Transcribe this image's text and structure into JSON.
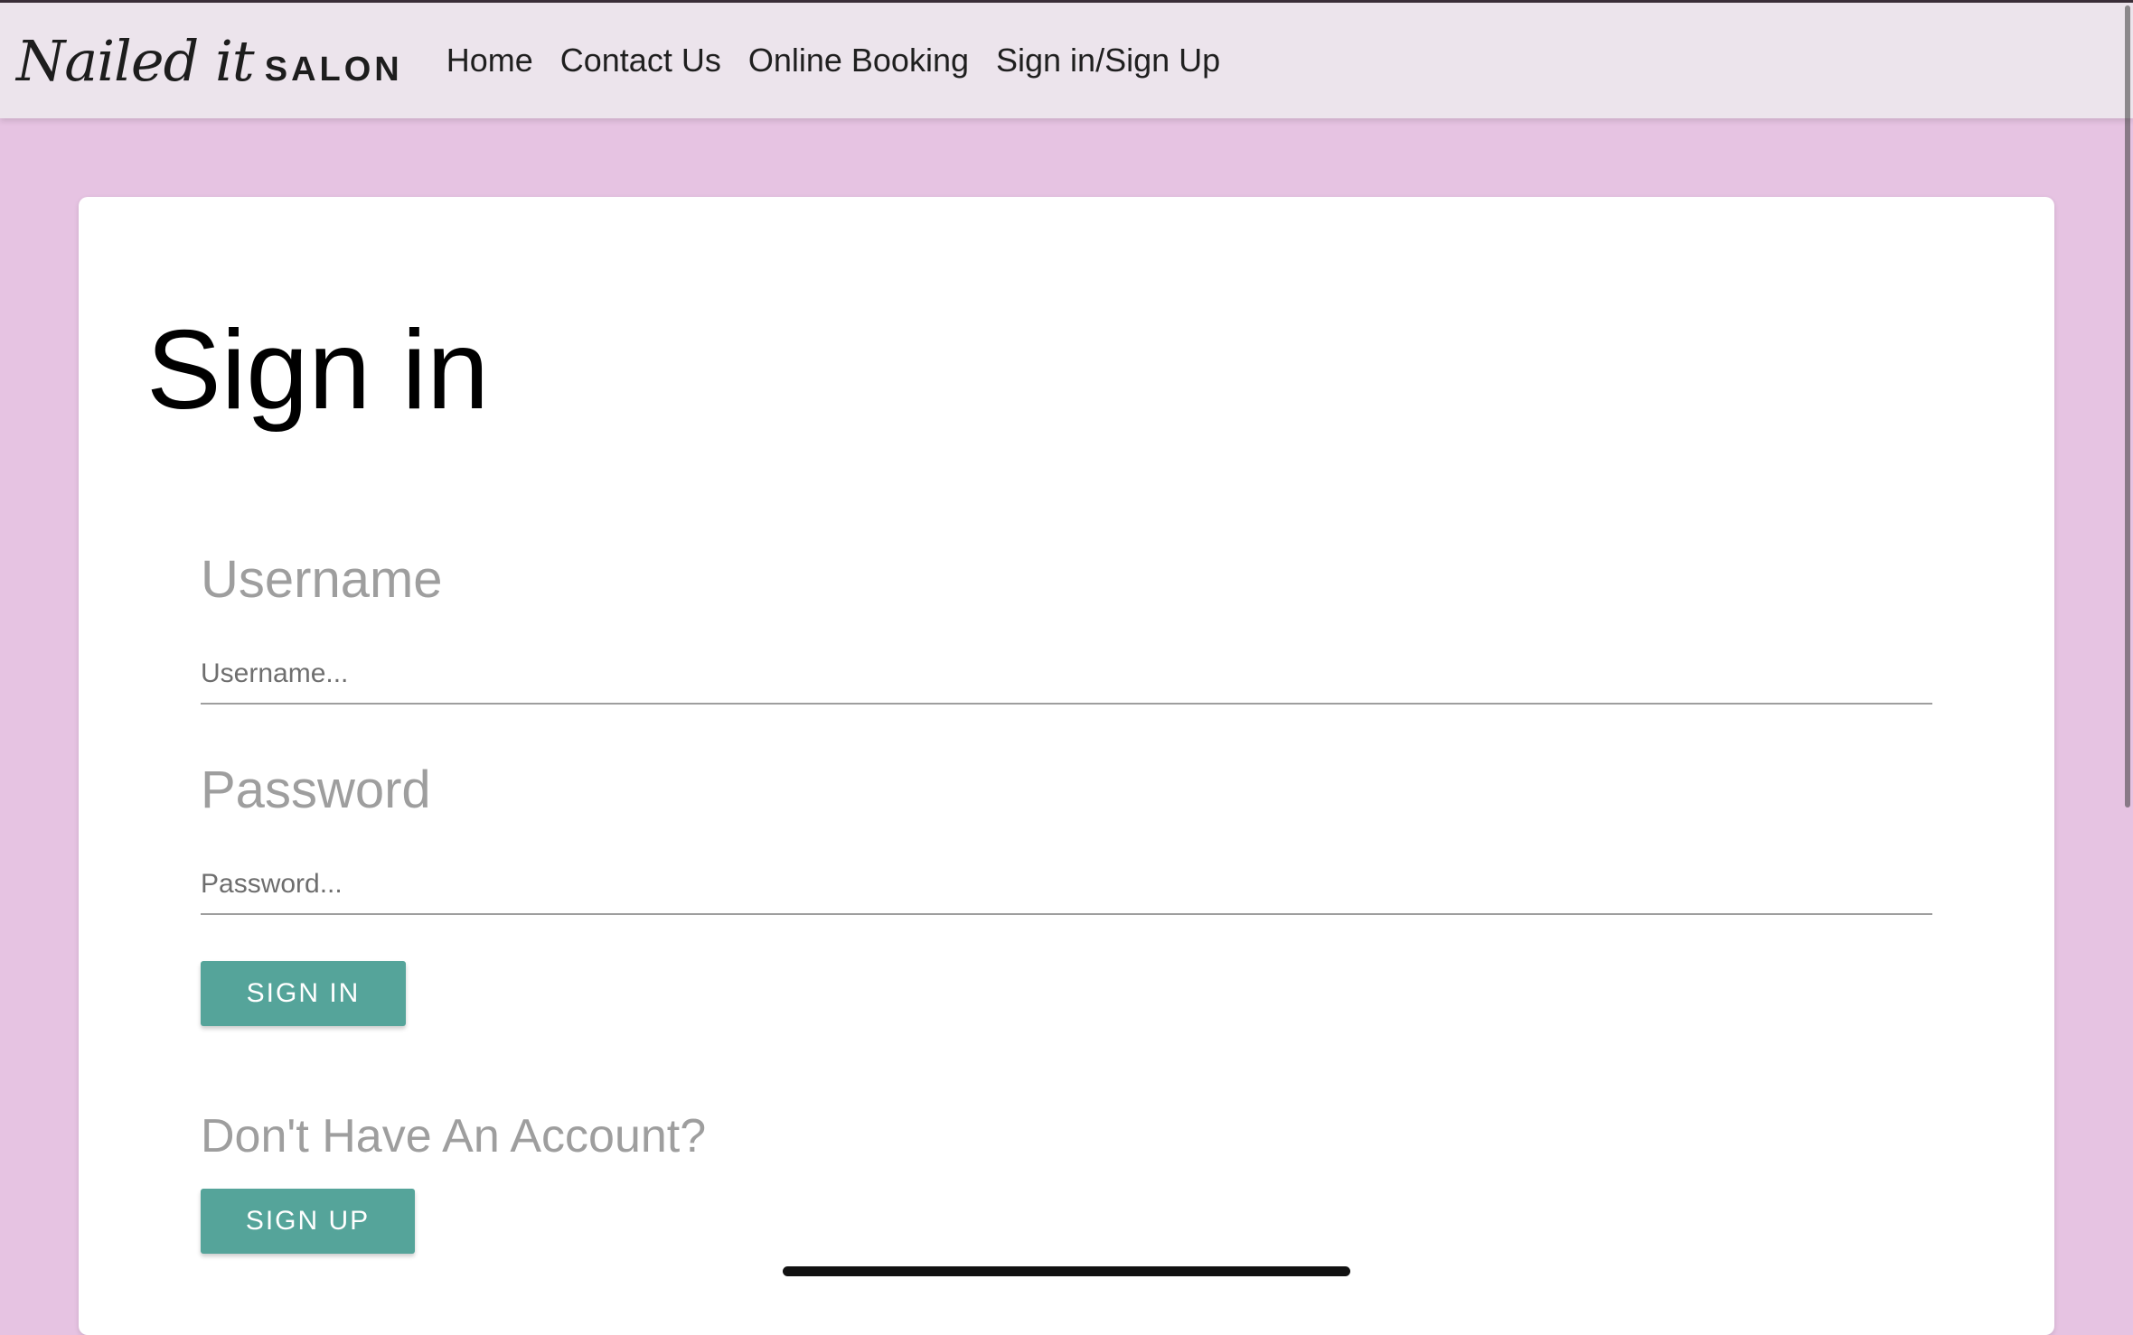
{
  "navbar": {
    "brand_script": "Nailed it",
    "brand_salon": "SALON",
    "links": [
      "Home",
      "Contact Us",
      "Online Booking",
      "Sign in/Sign Up"
    ]
  },
  "signin": {
    "title": "Sign in",
    "username_label": "Username",
    "username_placeholder": "Username...",
    "password_label": "Password",
    "password_placeholder": "Password...",
    "signin_button": "SIGN IN",
    "no_account_text": "Don't Have An Account?",
    "signup_button": "SIGN UP"
  },
  "colors": {
    "page_background": "#e6c3e2",
    "navbar_background": "#ece4ec",
    "button": "#55a49a"
  }
}
